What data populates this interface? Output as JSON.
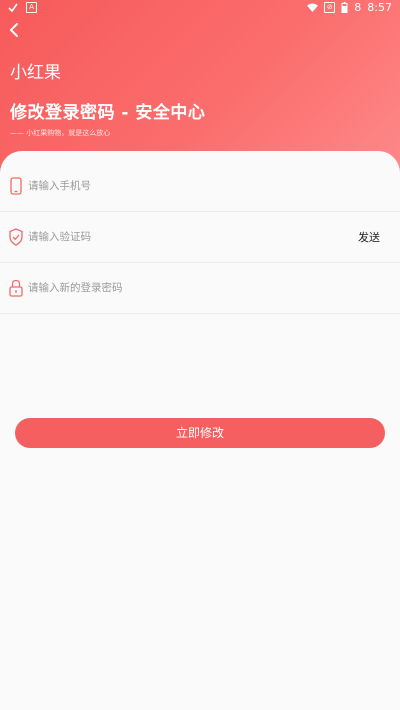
{
  "status_bar": {
    "time": "8:57",
    "battery": "8"
  },
  "header": {
    "app_name": "小红果",
    "title": "修改登录密码 - 安全中心",
    "subtitle": "—— 小红果购物，就是这么放心"
  },
  "form": {
    "phone_placeholder": "请输入手机号",
    "code_placeholder": "请输入验证码",
    "send_label": "发送",
    "password_placeholder": "请输入新的登录密码"
  },
  "submit_label": "立即修改",
  "colors": {
    "accent": "#f65f5f",
    "header_gradient_start": "#f75a5a",
    "header_gradient_end": "#fe8a8a"
  }
}
